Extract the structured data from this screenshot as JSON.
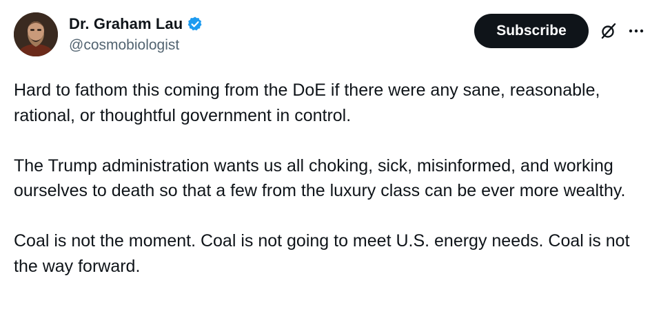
{
  "author": {
    "display_name": "Dr. Graham Lau",
    "handle": "@cosmobiologist",
    "verified": true,
    "avatar_icon": "profile-photo"
  },
  "actions": {
    "subscribe_label": "Subscribe",
    "grok_icon": "grok-icon",
    "more_icon": "more-icon"
  },
  "colors": {
    "text": "#0f1419",
    "secondary_text": "#536471",
    "verified_badge": "#1d9bf0",
    "button_bg": "#0f1419",
    "button_text": "#ffffff"
  },
  "tweet": {
    "paragraphs": [
      "Hard to fathom this coming from the DoE if there were any sane, reasonable, rational, or thoughtful government in control.",
      "The Trump administration wants us all choking, sick, misinformed, and working ourselves to death so that a few from the luxury class can be ever more wealthy.",
      "Coal is not the moment. Coal is not going to meet U.S. energy needs. Coal is not the way forward."
    ]
  }
}
